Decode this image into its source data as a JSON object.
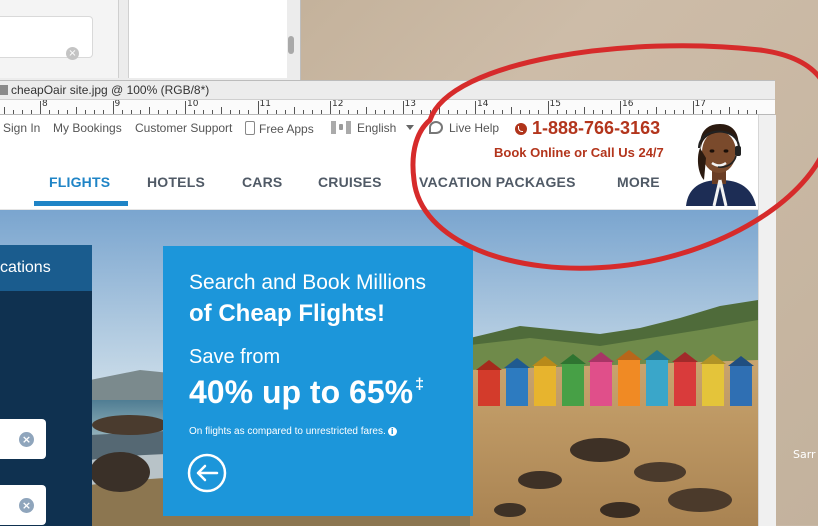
{
  "document": {
    "title": "cheapOair site.jpg @ 100% (RGB/8*)"
  },
  "ruler": {
    "numbers": [
      "8",
      "9",
      "10",
      "11",
      "12",
      "13",
      "14",
      "15",
      "16",
      "17"
    ]
  },
  "site": {
    "topbar": {
      "sign_in": "Sign In",
      "my_bookings": "My Bookings",
      "customer_support": "Customer Support",
      "free_apps": "Free Apps",
      "language": "English",
      "live_help": "Live Help"
    },
    "contact": {
      "phone": "1-888-766-3163",
      "tagline": "Book Online or Call Us 24/7"
    },
    "nav": {
      "items": [
        "FLIGHTS",
        "HOTELS",
        "CARS",
        "CRUISES",
        "VACATION PACKAGES",
        "MORE"
      ],
      "active": "FLIGHTS"
    },
    "left_panel": {
      "tab_label": "cations"
    },
    "promo": {
      "line1": "Search and Book Millions",
      "line2": "of Cheap Flights!",
      "line3": "Save from",
      "line4": "40% up to 65%",
      "line4_mark": "‡",
      "note": "On flights as compared to unrestricted fares."
    }
  },
  "desktop": {
    "label": "Sarr"
  },
  "colors": {
    "brand_blue": "#1f84c6",
    "promo_blue": "#1c96da",
    "phone_red": "#b3351c",
    "annotation_red": "#d62b2b"
  }
}
